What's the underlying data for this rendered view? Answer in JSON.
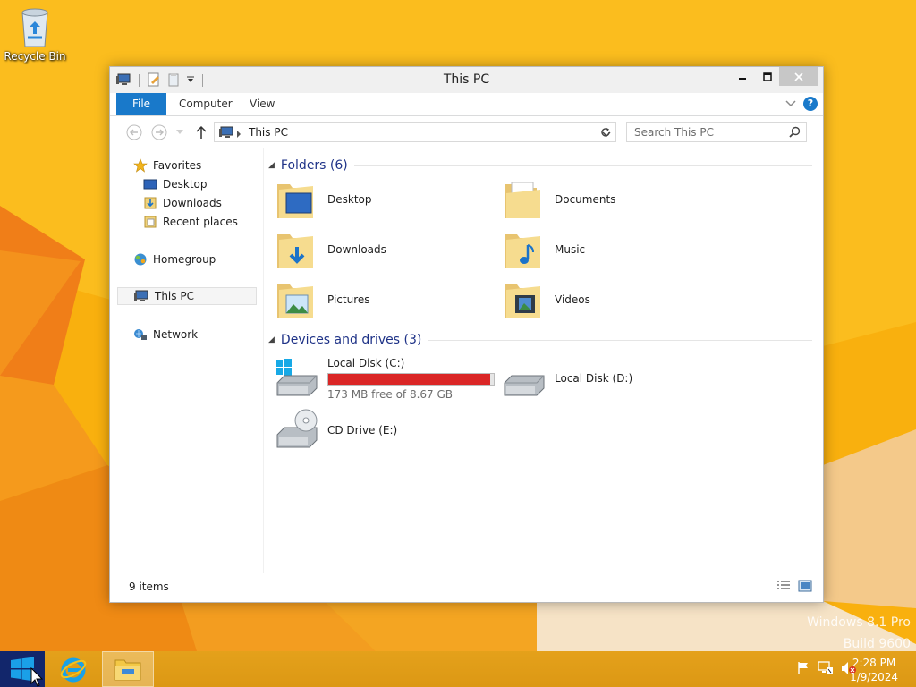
{
  "desktop": {
    "recycle_bin_label": "Recycle Bin",
    "watermark_line1": "Windows 8.1 Pro",
    "watermark_line2": "Build 9600"
  },
  "window": {
    "title": "This PC",
    "tabs": {
      "file": "File",
      "computer": "Computer",
      "view": "View"
    },
    "address": {
      "path": "This PC"
    },
    "search": {
      "placeholder": "Search This PC"
    },
    "nav": {
      "favorites": "Favorites",
      "desktop": "Desktop",
      "downloads": "Downloads",
      "recent": "Recent places",
      "homegroup": "Homegroup",
      "thispc": "This PC",
      "network": "Network"
    },
    "folders_group": "Folders (6)",
    "folders": {
      "desktop": "Desktop",
      "documents": "Documents",
      "downloads": "Downloads",
      "music": "Music",
      "pictures": "Pictures",
      "videos": "Videos"
    },
    "devices_group": "Devices and drives (3)",
    "drives": {
      "c_name": "Local Disk (C:)",
      "c_free": "173 MB free of 8.67 GB",
      "c_used_fraction": 0.98,
      "d_name": "Local Disk (D:)",
      "e_name": "CD Drive (E:)"
    },
    "status": "9 items"
  },
  "taskbar": {
    "time": "2:28 PM",
    "date": "1/9/2024"
  },
  "colors": {
    "accent": "#1979ca",
    "drive_bar_full": "#da2626",
    "group_header": "#1e3287",
    "wallpaper": "#f7a800"
  }
}
